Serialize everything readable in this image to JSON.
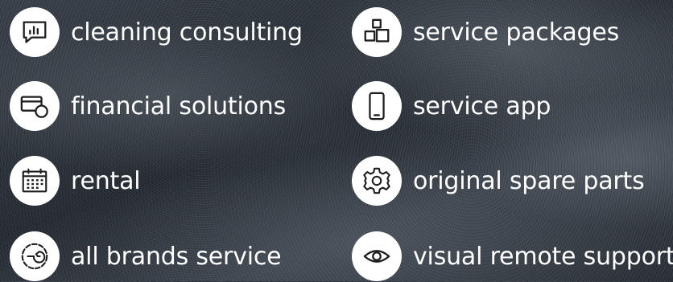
{
  "features": {
    "cleaning_consulting": {
      "label": "cleaning consulting",
      "icon": "chart-speech-bubble-icon"
    },
    "service_packages": {
      "label": "service packages",
      "icon": "packages-icon"
    },
    "financial_solutions": {
      "label": "financial solutions",
      "icon": "card-coin-icon"
    },
    "service_app": {
      "label": "service app",
      "icon": "smartphone-icon"
    },
    "rental": {
      "label": "rental",
      "icon": "calendar-icon"
    },
    "original_spare_parts": {
      "label": "original spare parts",
      "icon": "gear-icon"
    },
    "all_brands_service": {
      "label": "all brands service",
      "icon": "wrench-circle-icon"
    },
    "visual_remote_support": {
      "label": "visual remote support",
      "icon": "eye-icon"
    }
  },
  "colors": {
    "icon_circle": "#ffffff",
    "icon_stroke": "#1e1e1e",
    "label_text": "#ffffff"
  }
}
